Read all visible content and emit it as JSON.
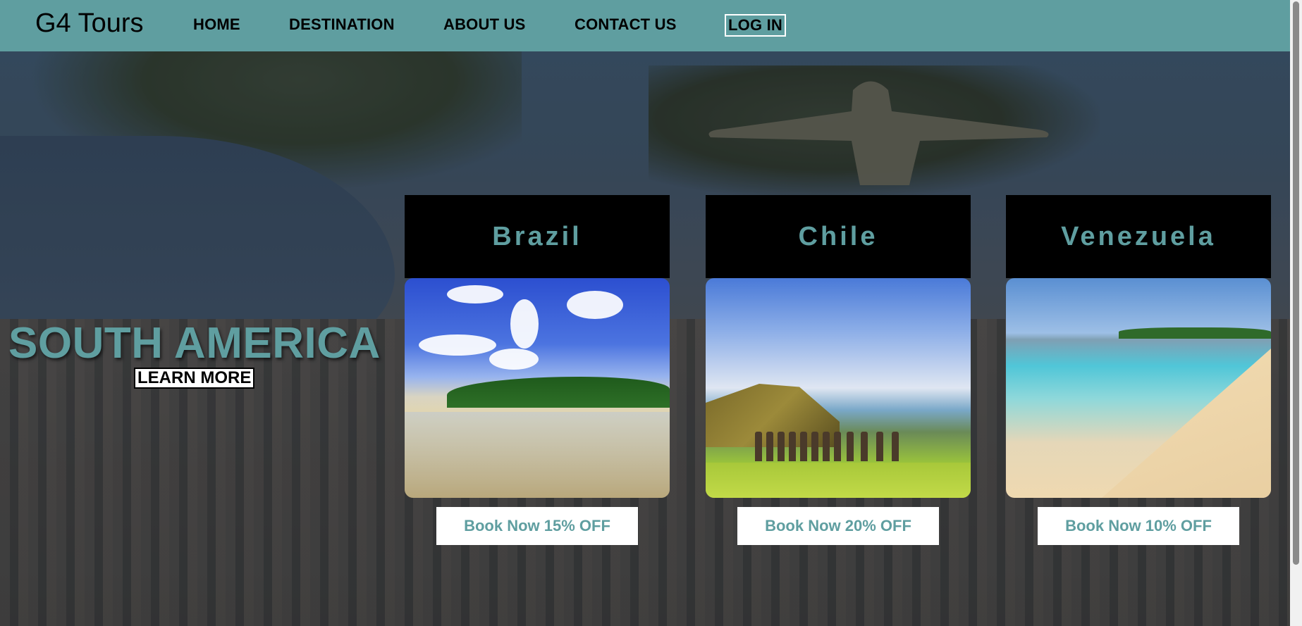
{
  "header": {
    "brand": "G4 Tours",
    "nav": {
      "home": "HOME",
      "destination": "DESTINATION",
      "about": "ABOUT US",
      "contact": "CONTACT US",
      "login": "LOG IN"
    }
  },
  "hero": {
    "title": "SOUTH AMERICA",
    "cta": "LEARN MORE"
  },
  "destinations": [
    {
      "name": "Brazil",
      "button": "Book Now 15% OFF"
    },
    {
      "name": "Chile",
      "button": "Book Now 20% OFF"
    },
    {
      "name": "Venezuela",
      "button": "Book Now 10% OFF"
    }
  ],
  "colors": {
    "accent": "#5f9ea0",
    "card_header": "#000000",
    "button_bg": "#ffffff"
  }
}
